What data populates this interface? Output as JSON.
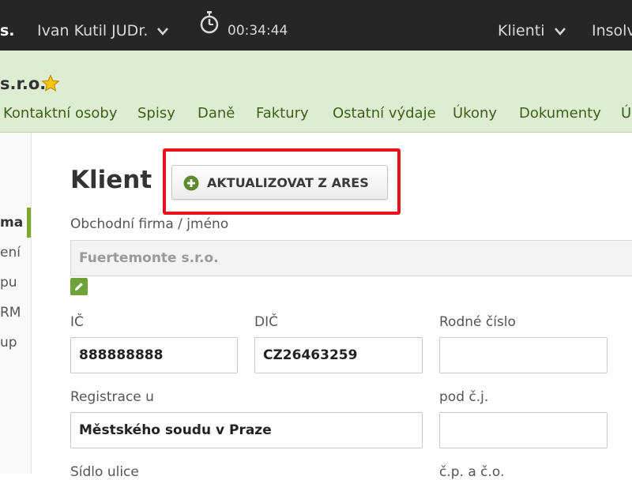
{
  "topbar": {
    "brand_fragment": "s.",
    "user_name": "Ivan Kutil JUDr.",
    "timer": "00:34:44",
    "clients_menu": "Klienti",
    "insolv_menu": "Insolv"
  },
  "header": {
    "company_name": "s.r.o.",
    "tabs": [
      {
        "label": "Kontaktní osoby"
      },
      {
        "label": "Spisy"
      },
      {
        "label": "Daně"
      },
      {
        "label": "Faktury"
      },
      {
        "label": "Ostatní výdaje"
      },
      {
        "label": "Úkony"
      },
      {
        "label": "Dokumenty"
      },
      {
        "label": "Ú"
      }
    ]
  },
  "sidebar": {
    "items": [
      {
        "label": "ma"
      },
      {
        "label": "ení"
      },
      {
        "label": "pu"
      },
      {
        "label": "RM"
      },
      {
        "label": "up"
      }
    ]
  },
  "main": {
    "title": "Klient",
    "ares_button_label": "AKTUALIZOVAT Z ARES",
    "company_label": "Obchodní firma / jméno",
    "company_value": "Fuertemonte s.r.o.",
    "ic_label": "IČ",
    "ic_value": "888888888",
    "dic_label": "DIČ",
    "dic_value": "CZ26463259",
    "rc_label": "Rodné číslo",
    "rc_value": "",
    "registrace_label": "Registrace u",
    "registrace_value": "Městského soudu v Praze",
    "podcj_label": "pod č.j.",
    "podcj_value": "",
    "sidlo_label": "Sídlo ulice",
    "cislo_label": "č.p. a č.o."
  },
  "colors": {
    "topbar_bg": "#262626",
    "header_bg": "#deedd1",
    "accent_green": "#7ca82a",
    "highlight_red": "#e8101a"
  }
}
